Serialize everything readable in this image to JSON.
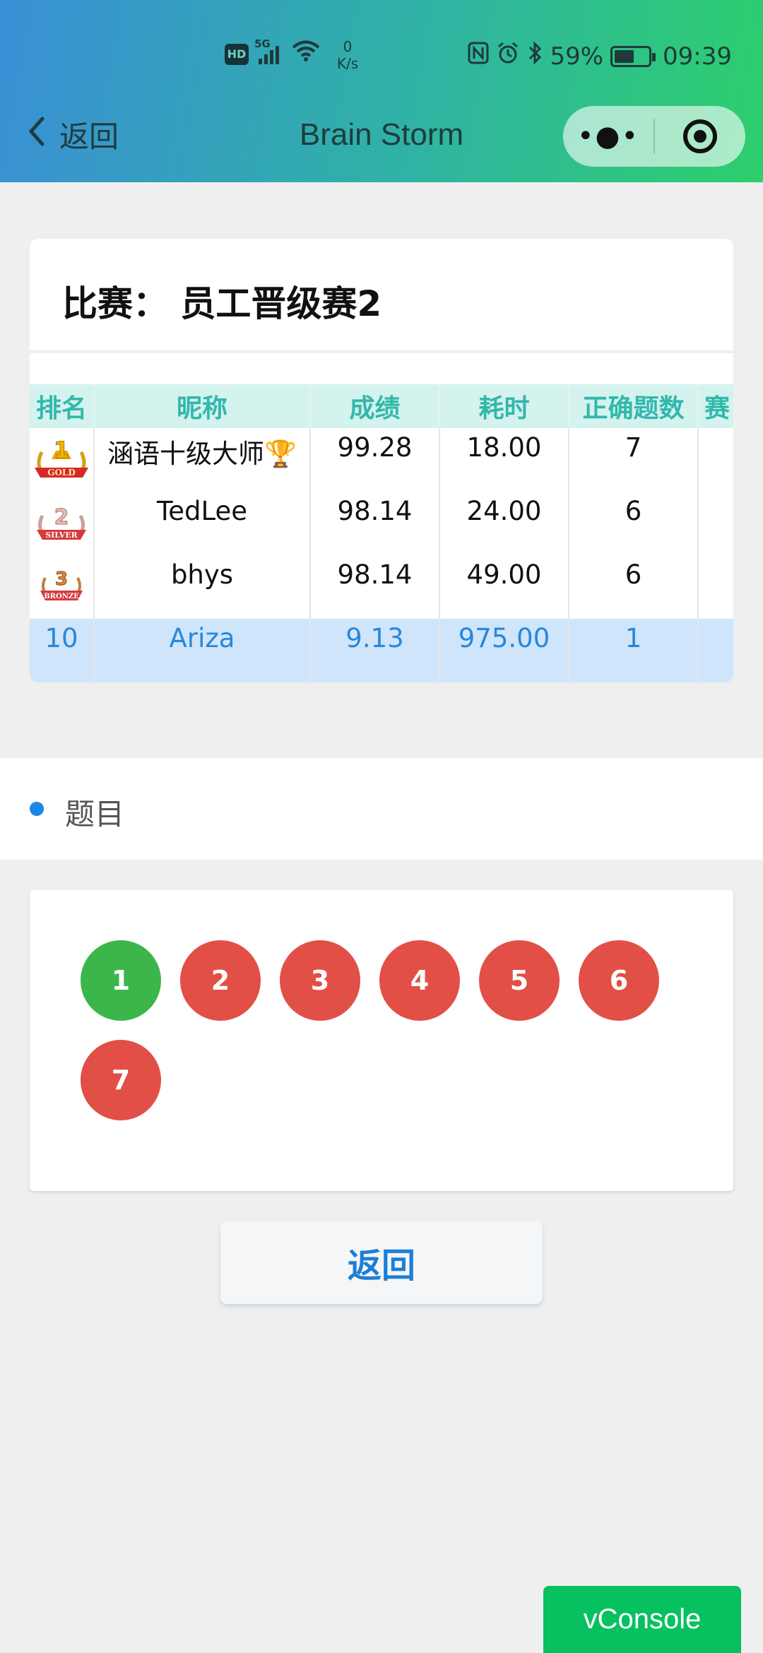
{
  "status_bar": {
    "hd": "HD",
    "network": "5G",
    "net_speed_value": "0",
    "net_speed_unit": "K/s",
    "battery_percent": "59%",
    "battery_level": 0.59,
    "time": "09:39"
  },
  "nav": {
    "back_label": "返回",
    "title": "Brain Storm",
    "more_icon": "more-dots-icon",
    "target_icon": "target-icon"
  },
  "contest": {
    "title": "比赛：  员工晋级赛2",
    "columns": [
      "排名",
      "昵称",
      "成绩",
      "耗时",
      "正确题数",
      "赛"
    ],
    "rows": [
      {
        "medal": "gold",
        "medal_text": "GOLD",
        "rank_num": "1",
        "nickname": "涵语十级大师🏆",
        "score": "99.28",
        "time": "18.00",
        "correct": "7"
      },
      {
        "medal": "silver",
        "medal_text": "SILVER",
        "rank_num": "2",
        "nickname": "TedLee",
        "score": "98.14",
        "time": "24.00",
        "correct": "6"
      },
      {
        "medal": "bronze",
        "medal_text": "BRONZE",
        "rank_num": "3",
        "nickname": "bhys",
        "score": "98.14",
        "time": "49.00",
        "correct": "6"
      }
    ],
    "me": {
      "rank": "10",
      "nickname": "Ariza",
      "score": "9.13",
      "time": "975.00",
      "correct": "1"
    }
  },
  "questions": {
    "label": "题目",
    "items": [
      {
        "num": "1",
        "status": "correct"
      },
      {
        "num": "2",
        "status": "wrong"
      },
      {
        "num": "3",
        "status": "wrong"
      },
      {
        "num": "4",
        "status": "wrong"
      },
      {
        "num": "5",
        "status": "wrong"
      },
      {
        "num": "6",
        "status": "wrong"
      },
      {
        "num": "7",
        "status": "wrong"
      }
    ]
  },
  "return_button": "返回",
  "vconsole_label": "vConsole",
  "colors": {
    "correct": "#3cb64a",
    "wrong": "#e14f47",
    "accent": "#1c7fd8",
    "table_header": "#31b8ad"
  }
}
